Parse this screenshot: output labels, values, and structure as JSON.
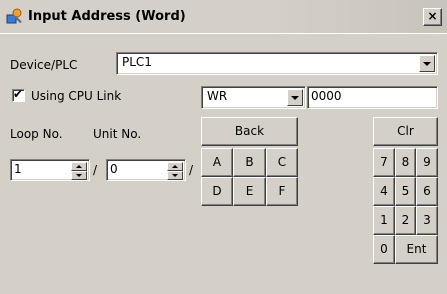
{
  "window": {
    "title": "Input Address (Word)",
    "close_label": "×"
  },
  "device": {
    "label": "Device/PLC",
    "value": "PLC1"
  },
  "cpu_link": {
    "label": "Using CPU Link",
    "checked": true,
    "check_glyph": "✔"
  },
  "address": {
    "type_value": "WR",
    "number_value": "0000"
  },
  "loop": {
    "label": "Loop No.",
    "value": "1"
  },
  "unit": {
    "label": "Unit No.",
    "value": "0"
  },
  "separator": "/",
  "keypad": {
    "back": "Back",
    "clr": "Clr",
    "hex": [
      "A",
      "B",
      "C",
      "D",
      "E",
      "F"
    ],
    "digits": [
      "7",
      "8",
      "9",
      "4",
      "5",
      "6",
      "1",
      "2",
      "3",
      "0"
    ],
    "ent": "Ent"
  },
  "icons": {
    "title": "app-icon",
    "dropdown": "chevron-down-icon",
    "spin_up": "spin-up-icon",
    "spin_down": "spin-down-icon"
  }
}
